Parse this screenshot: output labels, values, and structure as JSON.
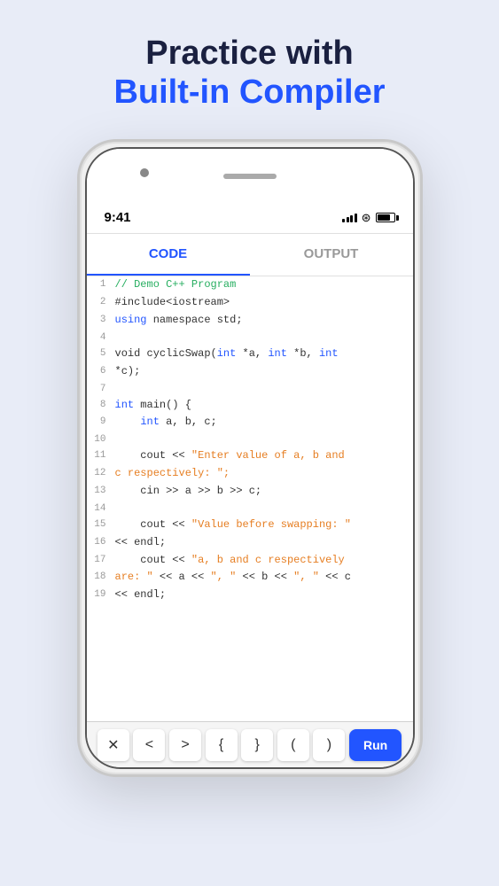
{
  "headline": {
    "line1": "Practice with",
    "line2": "Built-in Compiler"
  },
  "phone": {
    "status": {
      "time": "9:41"
    },
    "tabs": [
      {
        "label": "CODE",
        "active": true
      },
      {
        "label": "OUTPUT",
        "active": false
      }
    ],
    "code_lines": [
      {
        "num": 1,
        "content": "// Demo C++ Program",
        "type": "comment"
      },
      {
        "num": 2,
        "content": "#include<iostream>",
        "type": "directive"
      },
      {
        "num": 3,
        "content": "using namespace std;",
        "type": "mixed"
      },
      {
        "num": 4,
        "content": "",
        "type": "plain"
      },
      {
        "num": 5,
        "content": "void cyclicSwap(int *a, int *b, int",
        "type": "mixed"
      },
      {
        "num": 6,
        "content": "*c);",
        "type": "plain"
      },
      {
        "num": 7,
        "content": "",
        "type": "plain"
      },
      {
        "num": 8,
        "content": "int main() {",
        "type": "mixed"
      },
      {
        "num": 9,
        "content": "    int a, b, c;",
        "type": "mixed"
      },
      {
        "num": 10,
        "content": "",
        "type": "plain"
      },
      {
        "num": 11,
        "content": "    cout << \"Enter value of a, b and",
        "type": "mixed"
      },
      {
        "num": 12,
        "content": "c respectively: \";",
        "type": "string"
      },
      {
        "num": 13,
        "content": "    cin >> a >> b >> c;",
        "type": "plain"
      },
      {
        "num": 14,
        "content": "",
        "type": "plain"
      },
      {
        "num": 15,
        "content": "    cout << \"Value before swapping: \"",
        "type": "mixed"
      },
      {
        "num": 16,
        "content": "<< endl;",
        "type": "plain"
      },
      {
        "num": 17,
        "content": "    cout << \"a, b and c respectively",
        "type": "mixed"
      },
      {
        "num": 18,
        "content": "are: \" << a << \", \" << b << \", \" << c",
        "type": "mixed"
      },
      {
        "num": 19,
        "content": "<< endl;",
        "type": "plain"
      }
    ],
    "keyboard_keys": [
      "✕",
      "<",
      ">",
      "{",
      "}",
      "(",
      ")"
    ],
    "run_label": "Run"
  }
}
